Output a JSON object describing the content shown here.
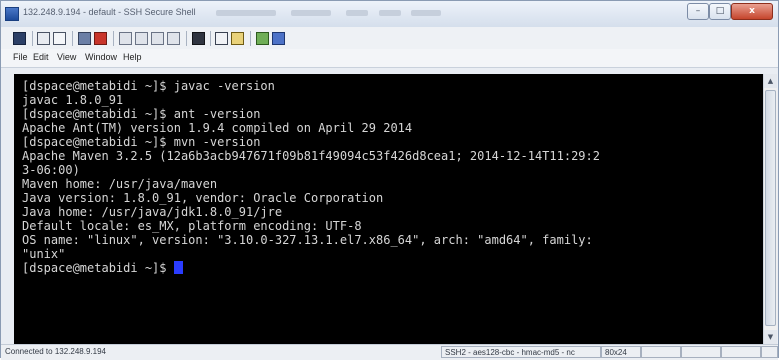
{
  "window": {
    "title": "132.248.9.194 - default - SSH Secure Shell"
  },
  "window_controls": {
    "minimize": "–",
    "maximize": "□",
    "close": "x"
  },
  "toolbar": {
    "icons": [
      "save-icon",
      "print-icon",
      "print-preview-icon",
      "quick-connect-icon",
      "profiles-icon",
      "copy-icon",
      "paste-icon",
      "find-icon",
      "new-terminal-icon",
      "file-transfer-icon",
      "settings-icon",
      "help-icon"
    ]
  },
  "menu": {
    "items": [
      "File",
      "Edit",
      "View",
      "Window",
      "Help"
    ]
  },
  "terminal": {
    "lines": [
      "[dspace@metabidi ~]$ javac -version",
      "javac 1.8.0_91",
      "[dspace@metabidi ~]$ ant -version",
      "Apache Ant(TM) version 1.9.4 compiled on April 29 2014",
      "[dspace@metabidi ~]$ mvn -version",
      "Apache Maven 3.2.5 (12a6b3acb947671f09b81f49094c53f426d8cea1; 2014-12-14T11:29:2",
      "3-06:00)",
      "Maven home: /usr/java/maven",
      "Java version: 1.8.0_91, vendor: Oracle Corporation",
      "Java home: /usr/java/jdk1.8.0_91/jre",
      "Default locale: es_MX, platform encoding: UTF-8",
      "OS name: \"linux\", version: \"3.10.0-327.13.1.el7.x86_64\", arch: \"amd64\", family:",
      "\"unix\"",
      "[dspace@metabidi ~]$ "
    ]
  },
  "statusbar": {
    "connection": "Connected to 132.248.9.194",
    "cipher": "SSH2 - aes128-cbc - hmac-md5 - nc",
    "size": "80x24"
  },
  "colors": {
    "terminal_bg": "#000000",
    "terminal_fg": "#d6d6d6",
    "cursor": "#2a3cff"
  }
}
